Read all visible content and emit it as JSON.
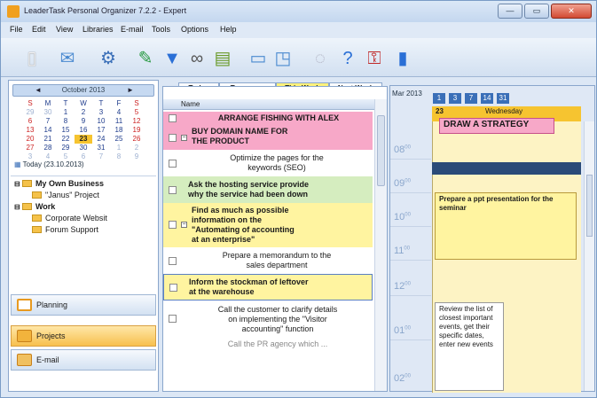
{
  "window": {
    "title": "LeaderTask Personal Organizer 7.2.2 - Expert",
    "min": "—",
    "max": "▭",
    "close": "✕"
  },
  "menu": [
    "File",
    "Edit",
    "View",
    "Libraries",
    "E-mail",
    "Tools",
    "Options",
    "Help"
  ],
  "toolbar_icons": [
    "new-task-icon",
    "email-icon",
    "tools-icon",
    "pin-icon",
    "filter-icon",
    "binoculars-icon",
    "mail-icon",
    "folder-icon",
    "document-icon",
    "circle-icon",
    "help-icon",
    "key-icon",
    "phone-icon"
  ],
  "calendar": {
    "month_label": "October 2013",
    "prev": "◄",
    "next": "►",
    "weekdays": [
      "S",
      "M",
      "T",
      "W",
      "T",
      "F",
      "S"
    ],
    "weeks": [
      [
        "29",
        "30",
        "1",
        "2",
        "3",
        "4",
        "5"
      ],
      [
        "6",
        "7",
        "8",
        "9",
        "10",
        "11",
        "12"
      ],
      [
        "13",
        "14",
        "15",
        "16",
        "17",
        "18",
        "19"
      ],
      [
        "20",
        "21",
        "22",
        "23",
        "24",
        "25",
        "26"
      ],
      [
        "27",
        "28",
        "29",
        "30",
        "31",
        "1",
        "2"
      ],
      [
        "3",
        "4",
        "5",
        "6",
        "7",
        "8",
        "9"
      ]
    ],
    "selected": "23",
    "today_link": "Today (23.10.2013)"
  },
  "projects": [
    {
      "label": "My Own Business",
      "level": 0
    },
    {
      "label": "\"Janus\" Project",
      "level": 1
    },
    {
      "label": "Work",
      "level": 0
    },
    {
      "label": "Corporate Websit",
      "level": 1
    },
    {
      "label": "Forum Support",
      "level": 1
    }
  ],
  "nav": [
    {
      "label": "Planning",
      "active": false
    },
    {
      "label": "Projects",
      "active": true
    },
    {
      "label": "E-mail",
      "active": false
    }
  ],
  "tabs": [
    "Today",
    "Tomorrow",
    "This Week",
    "Next Week"
  ],
  "list_header": "Name",
  "tasks": [
    {
      "lines": [
        "ARRANGE FISHING WITH ALEX"
      ],
      "bold": true,
      "bg": "#f7a8c8"
    },
    {
      "lines": [
        "BUY DOMAIN NAME FOR",
        "THE PRODUCT"
      ],
      "bold": true,
      "bg": "#f7a8c8"
    },
    {
      "lines": [
        "Optimize the pages for the",
        "keywords (SEO)"
      ],
      "bold": false,
      "bg": "#ffffff"
    },
    {
      "lines": [
        "Ask the hosting service provide",
        "why the service had been down"
      ],
      "bold": true,
      "bg": "#d5edbf"
    },
    {
      "lines": [
        "Find as much as possible",
        "information on the",
        "\"Automating of accounting",
        "at an enterprise\""
      ],
      "bold": true,
      "bg": "#fff4a0"
    },
    {
      "lines": [
        "Prepare a memorandum to the",
        "sales department"
      ],
      "bold": false,
      "bg": "#ffffff"
    },
    {
      "lines": [
        "Inform the stockman of leftover",
        "at the warehouse"
      ],
      "bold": true,
      "bg": "#fff4a0"
    },
    {
      "lines": [
        "Call the customer to clarify details",
        "on implementing the \"Visitor",
        "accounting\" function"
      ],
      "bold": false,
      "bg": "#ffffff"
    },
    {
      "lines": [
        "Call the PR agency which ..."
      ],
      "bold": false,
      "bg": "#ffffff"
    }
  ],
  "day_view": {
    "month_label": "Mar 2013",
    "view_buttons": [
      "1",
      "3",
      "7",
      "14",
      "31"
    ],
    "day_number": "23",
    "day_name": "Wednesday",
    "header_event": "DRAW A STRATEGY",
    "times": [
      "08",
      "09",
      "10",
      "11",
      "12",
      "01",
      "02"
    ],
    "events": [
      {
        "text": "Prepare a ppt presentation for the seminar"
      },
      {
        "text": "Review the list of closest important events, get their specific dates, enter new events"
      }
    ]
  }
}
